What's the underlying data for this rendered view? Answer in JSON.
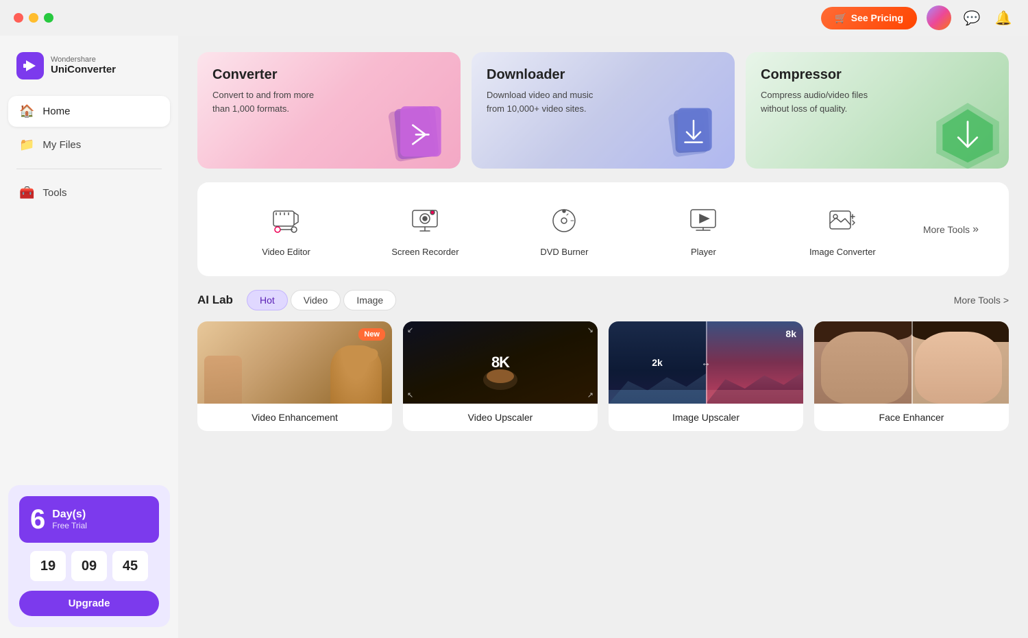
{
  "titlebar": {
    "pricing_label": "See Pricing",
    "chat_icon": "💬",
    "notification_icon": "🔔"
  },
  "sidebar": {
    "logo_name": "Wondershare",
    "logo_product": "UniConverter",
    "nav": [
      {
        "id": "home",
        "label": "Home",
        "icon": "🏠"
      },
      {
        "id": "my-files",
        "label": "My Files",
        "icon": "📁"
      },
      {
        "id": "tools",
        "label": "Tools",
        "icon": "🧰"
      }
    ],
    "trial": {
      "days": "6",
      "days_label": "Day(s)",
      "free_label": "Free Trial",
      "hours": "19",
      "minutes": "09",
      "seconds": "45",
      "upgrade_label": "Upgrade"
    }
  },
  "feature_cards": [
    {
      "id": "converter",
      "title": "Converter",
      "desc": "Convert to and from more than 1,000 formats.",
      "theme": "pink"
    },
    {
      "id": "downloader",
      "title": "Downloader",
      "desc": "Download video and music from 10,000+ video sites.",
      "theme": "purple"
    },
    {
      "id": "compressor",
      "title": "Compressor",
      "desc": "Compress audio/video files without loss of quality.",
      "theme": "green"
    }
  ],
  "tools": [
    {
      "id": "video-editor",
      "label": "Video Editor"
    },
    {
      "id": "screen-recorder",
      "label": "Screen Recorder"
    },
    {
      "id": "dvd-burner",
      "label": "DVD Burner"
    },
    {
      "id": "player",
      "label": "Player"
    },
    {
      "id": "image-converter",
      "label": "Image Converter"
    }
  ],
  "more_tools_label": "More Tools",
  "ai_lab": {
    "title": "AI Lab",
    "tabs": [
      "Hot",
      "Video",
      "Image"
    ],
    "active_tab": "Hot",
    "more_tools_label": "More Tools >",
    "cards": [
      {
        "id": "video-enhancement",
        "label": "Video Enhancement",
        "badge": "New",
        "thumb_type": "video-enhance"
      },
      {
        "id": "video-upscaler",
        "label": "Video Upscaler",
        "badge": "",
        "thumb_type": "video-upscaler",
        "badge_res": "8K"
      },
      {
        "id": "image-upscaler",
        "label": "Image Upscaler",
        "badge": "",
        "thumb_type": "img-upscaler",
        "badge_2k": "2k",
        "badge_8k": "8k"
      },
      {
        "id": "face-enhancer",
        "label": "Face Enhancer",
        "badge": "",
        "thumb_type": "face"
      }
    ]
  }
}
